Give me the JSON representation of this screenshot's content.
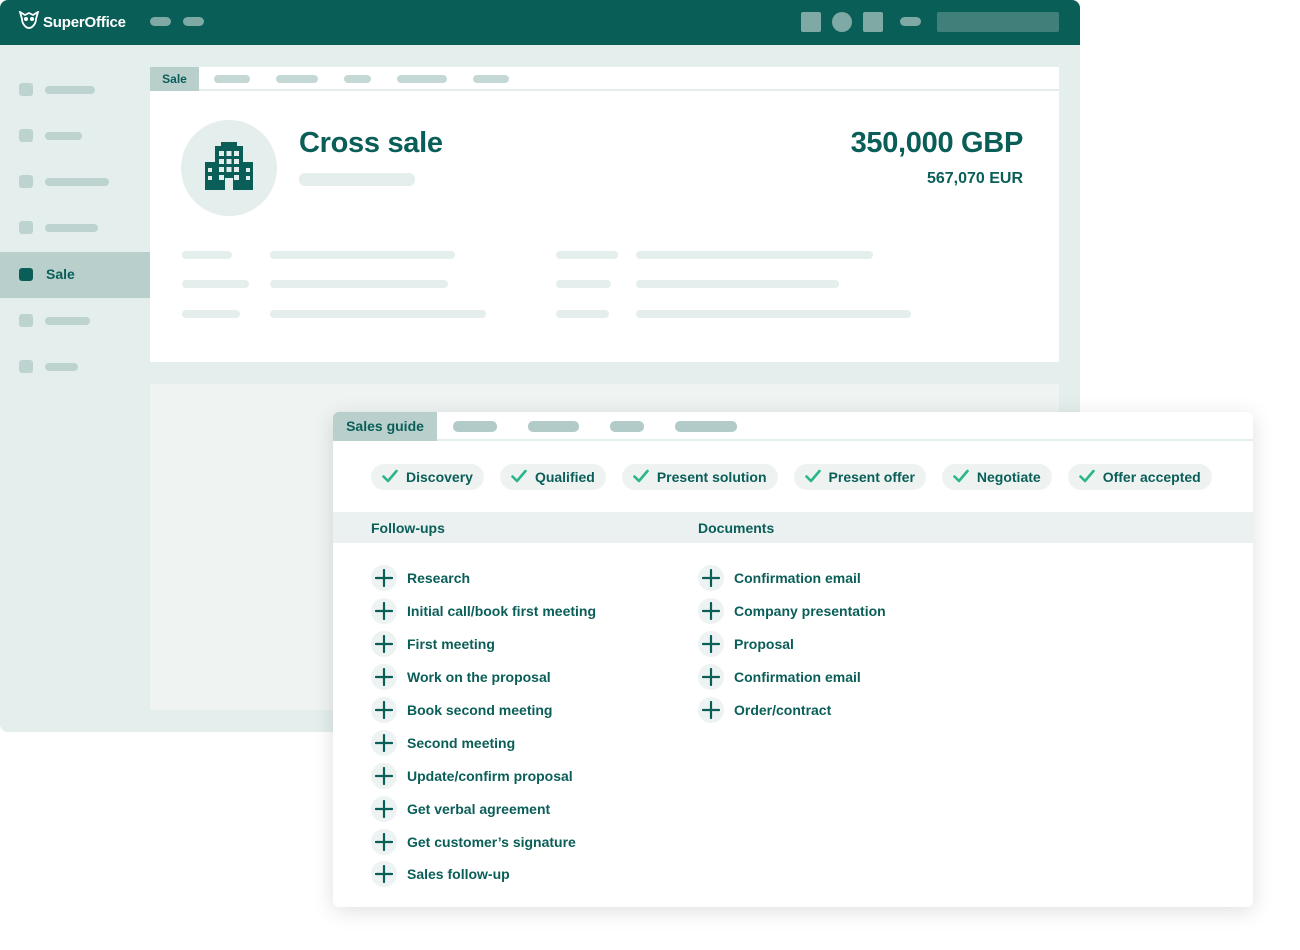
{
  "app": {
    "logo_text": "SuperOffice",
    "logo_icon": "owl-icon"
  },
  "sidebar": {
    "active_label": "Sale"
  },
  "sale": {
    "tab_label": "Sale",
    "title": "Cross sale",
    "amount": "350,000 GBP",
    "amount_converted": "567,070 EUR",
    "icon": "building-icon"
  },
  "guide": {
    "tab_label": "Sales guide",
    "stages": [
      {
        "label": "Discovery",
        "done": true
      },
      {
        "label": "Qualified",
        "done": true
      },
      {
        "label": "Present solution",
        "done": true
      },
      {
        "label": "Present offer",
        "done": true
      },
      {
        "label": "Negotiate",
        "done": true
      },
      {
        "label": "Offer accepted",
        "done": true
      }
    ],
    "followups_header": "Follow-ups",
    "documents_header": "Documents",
    "followups": [
      "Research",
      "Initial call/book first meeting",
      "First meeting",
      "Work on the proposal",
      "Book second meeting",
      "Second meeting",
      "Update/confirm proposal",
      "Get verbal agreement",
      "Get customer’s signature",
      "Sales follow-up"
    ],
    "documents": [
      "Confirmation email",
      "Company presentation",
      "Proposal",
      "Confirmation email",
      "Order/contract"
    ]
  },
  "colors": {
    "brand": "#0a5e58",
    "check": "#2bb58a",
    "placeholder": "#e4eeec"
  }
}
